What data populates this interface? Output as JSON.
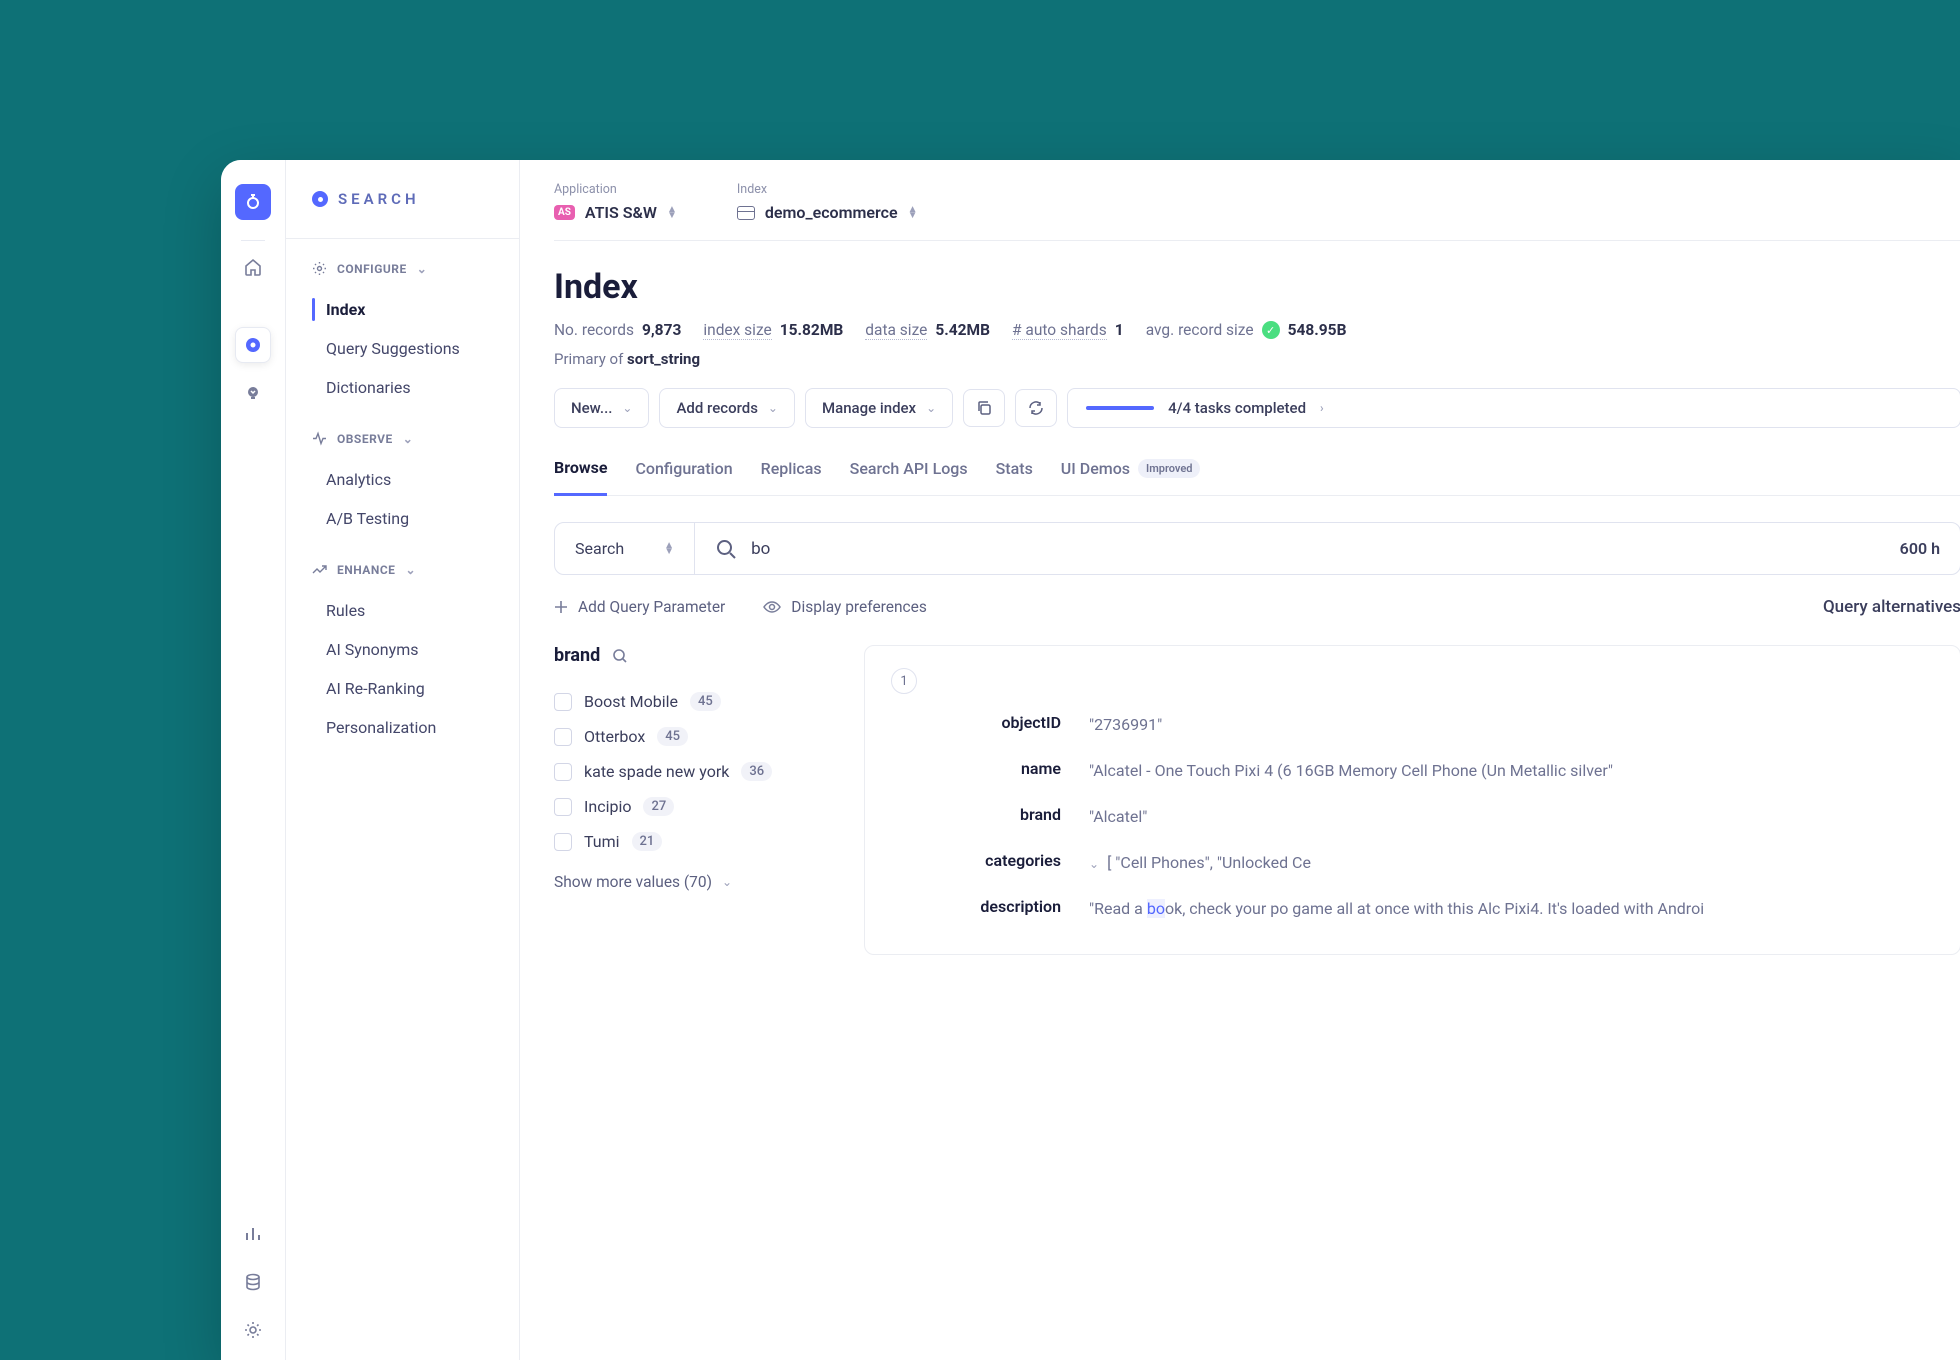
{
  "sidebar_logo": "SEARCH",
  "sections": {
    "configure": {
      "label": "CONFIGURE",
      "items": [
        "Index",
        "Query Suggestions",
        "Dictionaries"
      ]
    },
    "observe": {
      "label": "OBSERVE",
      "items": [
        "Analytics",
        "A/B Testing"
      ]
    },
    "enhance": {
      "label": "ENHANCE",
      "items": [
        "Rules",
        "AI Synonyms",
        "AI Re-Ranking",
        "Personalization"
      ]
    }
  },
  "top": {
    "app_label": "Application",
    "app_badge": "AS",
    "app_value": "ATIS S&W",
    "index_label": "Index",
    "index_value": "demo_ecommerce"
  },
  "page_title": "Index",
  "stats": {
    "records_label": "No. records",
    "records_value": "9,873",
    "size_label": "index size",
    "size_value": "15.82MB",
    "data_label": "data size",
    "data_value": "5.42MB",
    "shards_label": "# auto shards",
    "shards_value": "1",
    "avg_label": "avg. record size",
    "avg_value": "548.95B"
  },
  "primary_of_label": "Primary of ",
  "primary_of_value": "sort_string",
  "toolbar": {
    "new": "New...",
    "add": "Add records",
    "manage": "Manage index",
    "tasks": "4/4 tasks completed"
  },
  "tabs": [
    "Browse",
    "Configuration",
    "Replicas",
    "Search API Logs",
    "Stats",
    "UI Demos"
  ],
  "improved_badge": "Improved",
  "search": {
    "mode": "Search",
    "value": "bo",
    "hits": "600 h"
  },
  "sub_actions": {
    "add_param": "Add Query Parameter",
    "display_prefs": "Display preferences",
    "query_alt": "Query alternatives"
  },
  "facet": {
    "title": "brand",
    "show_more": "Show more values (70)",
    "items": [
      {
        "name": "Boost Mobile",
        "count": "45"
      },
      {
        "name": "Otterbox",
        "count": "45"
      },
      {
        "name": "kate spade new york",
        "count": "36"
      },
      {
        "name": "Incipio",
        "count": "27"
      },
      {
        "name": "Tumi",
        "count": "21"
      }
    ]
  },
  "record": {
    "num": "1",
    "objectID_key": "objectID",
    "objectID_val": "\"2736991\"",
    "name_key": "name",
    "name_val": "\"Alcatel - One Touch Pixi 4 (6 16GB Memory Cell Phone (Un Metallic silver\"",
    "brand_key": "brand",
    "brand_val": "\"Alcatel\"",
    "categories_key": "categories",
    "categories_val": "[ \"Cell Phones\", \"Unlocked Ce",
    "description_key": "description",
    "description_pre": "\"Read a ",
    "description_hl": "bo",
    "description_post": "ok, check your po game all at once with this Alc Pixi4. It's loaded with Androi"
  }
}
